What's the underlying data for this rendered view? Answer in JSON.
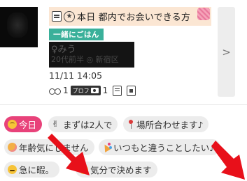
{
  "profile": {
    "banner_text": "本日 都内でお会いできる方",
    "tag": "一緒にごはん",
    "name": "♀みう",
    "sub": "20代前半 ◎ 新宿区",
    "datetime": "11/11 14:05",
    "footprints_count": "1",
    "profile_label": "プロフ",
    "photos_count": "1"
  },
  "chips": [
    {
      "label": "今日",
      "icon": "grinning-face-icon",
      "active": true
    },
    {
      "label": "まずは2人で",
      "icon": "peace-hand-icon",
      "active": false
    },
    {
      "label": "場所合わせます♪",
      "icon": "pin-icon",
      "active": false
    },
    {
      "label": "年齢気にしません",
      "icon": "blush-face-icon",
      "active": false
    },
    {
      "label": "いつもと違うことしたい♪",
      "icon": "party-popper-icon",
      "active": false
    },
    {
      "label": "急に暇。",
      "icon": "sleepy-face-icon",
      "active": false
    },
    {
      "label": "気分で決めます",
      "icon": "relieved-face-icon",
      "active": false
    }
  ],
  "colors": {
    "accent_pink": "#e8427a",
    "tag_green": "#3ab09a",
    "banner_bg": "#fbe6d3",
    "arrow_red": "#e8101a"
  }
}
